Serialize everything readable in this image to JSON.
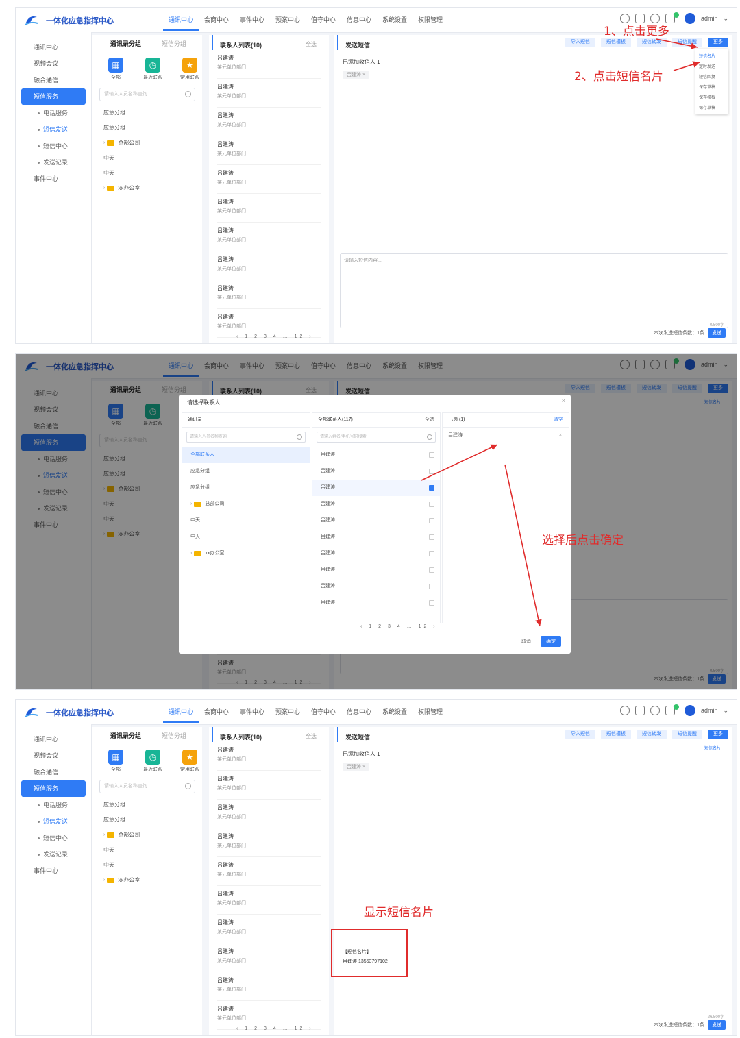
{
  "app": {
    "title": "一体化应急指挥中心",
    "nav": [
      "通讯中心",
      "会商中心",
      "事件中心",
      "预案中心",
      "值守中心",
      "信息中心",
      "系统设置",
      "权限管理"
    ],
    "user": "admin"
  },
  "sidebar": {
    "items": [
      "通讯中心",
      "视频会议",
      "融合通信",
      "短信服务",
      "事件中心"
    ],
    "subs": [
      "电话服务",
      "短信发送",
      "短信中心",
      "发送记录"
    ]
  },
  "group": {
    "tabs": [
      "通讯录分组",
      "短信分组"
    ],
    "icons": [
      {
        "label": "全部",
        "color": "#2f7bf5",
        "glyph": "▦"
      },
      {
        "label": "最近联系",
        "color": "#18b596",
        "glyph": "◷"
      },
      {
        "label": "常用联系",
        "color": "#f5a20b",
        "glyph": "★"
      }
    ],
    "search_placeholder": "请输入人员名称查询",
    "tree": [
      "应急分组",
      "应急分组",
      "总部公司",
      "中天",
      "中天",
      "xx办公室"
    ]
  },
  "contacts": {
    "header": "联系人列表(10)",
    "header_right": "全选",
    "item_name": "吕建涛",
    "item_sub": "某元单位部门",
    "pager": "‹ 1 2 3 4 … 12 ›"
  },
  "send": {
    "title": "发送短信",
    "buttons": [
      "导入短信",
      "短信模板",
      "短信转发",
      "短信提醒",
      "更多"
    ],
    "recipient_label": "已添加收信人 1",
    "recipient_tag": "吕建涛 ×",
    "textarea_placeholder": "请输入短信内容...",
    "counter": "0/500字",
    "bottom_label": "本次发送短信条数：1条",
    "send_btn": "发送",
    "dropdown": [
      "短信名片",
      "定时发送",
      "短信回复",
      "保存草稿",
      "保存模板",
      "保存草稿"
    ],
    "card_text_1": "【短信名片】",
    "card_text_2": "吕建涛 13553797102",
    "counter3": "26/500字"
  },
  "dialog": {
    "title": "请选择联系人",
    "col1_header": "通讯录",
    "col1_search": "请输入人员名称查询",
    "col1_rows": [
      "全部联系人",
      "应急分组",
      "应急分组",
      "总部公司",
      "中天",
      "中天",
      "xx办公室"
    ],
    "col2_header": "全部联系人(117)",
    "col2_header_right": "全选",
    "col2_search": "请输入姓名/手机号码搜索",
    "col2_name": "吕建涛",
    "col3_header": "已选 (1)",
    "col3_header_right": "清空",
    "col3_item": "吕建涛",
    "pager": "‹ 1 2 3 4 … 12 ›",
    "cancel": "取消",
    "ok": "确定"
  },
  "annotations": {
    "step1": "1、点击更多",
    "step2": "2、点击短信名片",
    "step3": "选择后点击确定",
    "step4": "显示短信名片"
  },
  "colors": {
    "primary": "#2f7bf5",
    "annotation": "#e02c2c"
  }
}
